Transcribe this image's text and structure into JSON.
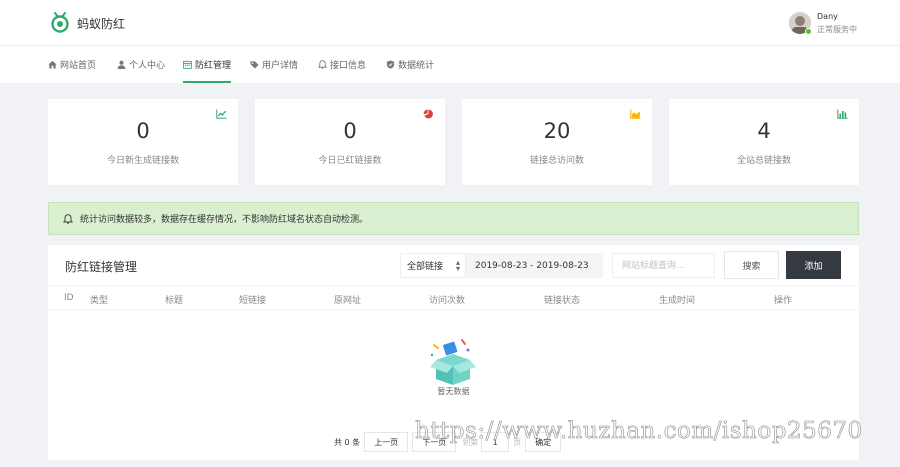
{
  "app": {
    "brand": "蚂蚁防红"
  },
  "user": {
    "name": "Dany",
    "status": "正常服务中"
  },
  "nav": {
    "items": [
      {
        "label": "网站首页",
        "icon": "home-icon"
      },
      {
        "label": "个人中心",
        "icon": "user-icon"
      },
      {
        "label": "防红管理",
        "icon": "calendar-icon",
        "active": true
      },
      {
        "label": "用户详情",
        "icon": "tag-icon"
      },
      {
        "label": "接口信息",
        "icon": "bell-icon"
      },
      {
        "label": "数据统计",
        "icon": "shield-icon"
      }
    ]
  },
  "stats": [
    {
      "value": "0",
      "label": "今日新生成链接数",
      "icon": "line-chart-icon",
      "color": "#2eaa6f"
    },
    {
      "value": "0",
      "label": "今日已红链接数",
      "icon": "pie-chart-icon",
      "color": "#e23d3d"
    },
    {
      "value": "20",
      "label": "链接总访问数",
      "icon": "area-chart-icon",
      "color": "#f5b800"
    },
    {
      "value": "4",
      "label": "全站总链接数",
      "icon": "bar-chart-icon",
      "color": "#2eaa6f"
    }
  ],
  "notice": {
    "text": "统计访问数据较多，数据存在缓存情况，不影响防红域名状态自动检测。"
  },
  "panel": {
    "title": "防红链接管理",
    "filter": {
      "selected": "全部链接"
    },
    "date_range": "2019-08-23 - 2019-08-23",
    "search_placeholder": "网站标题查询...",
    "search_label": "搜索",
    "add_label": "添加",
    "columns": [
      "ID",
      "类型",
      "标题",
      "短链接",
      "原网址",
      "访问次数",
      "链接状态",
      "生成时间",
      "操作"
    ],
    "empty_text": "暂无数据"
  },
  "pagination": {
    "total": "共 0 条",
    "prev": "上一页",
    "next": "下一页",
    "goto": "到第",
    "page_value": "1",
    "page_unit": "页",
    "confirm": "确定"
  },
  "watermark": "https://www.huzhan.com/ishop25670",
  "colors": {
    "accent": "#2eaa6f",
    "dark_button": "#353a41",
    "notice_bg": "#d9efcf"
  }
}
